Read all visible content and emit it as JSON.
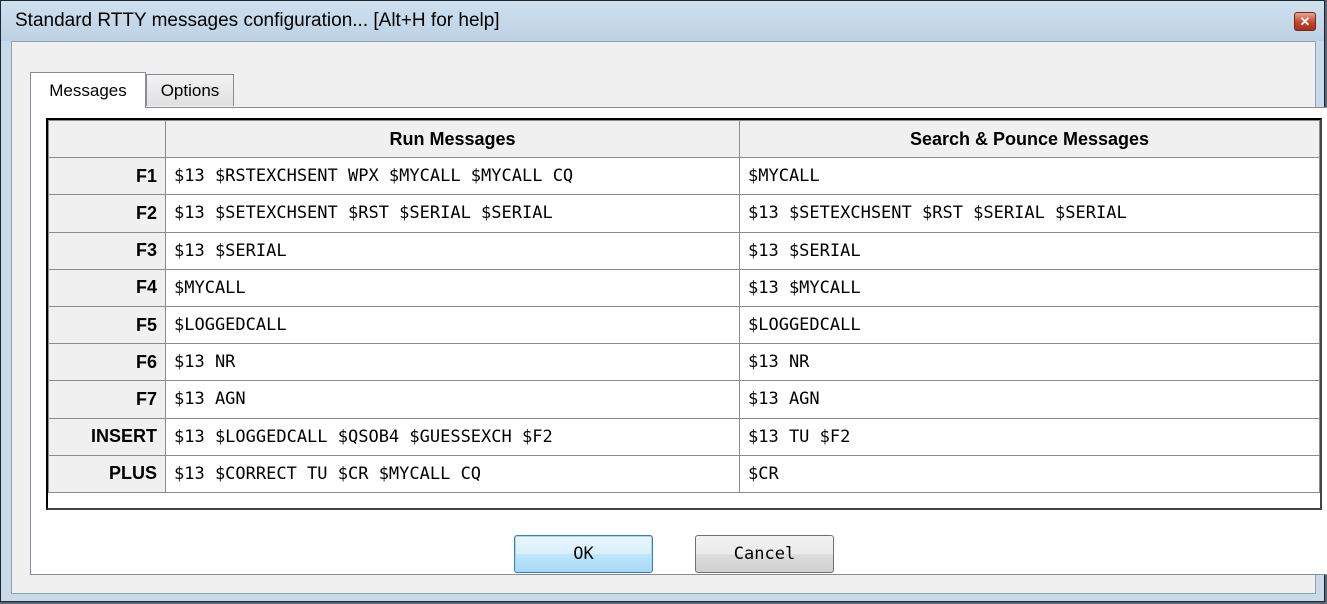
{
  "window": {
    "title": "Standard RTTY messages configuration... [Alt+H for help]",
    "close_glyph": "✕"
  },
  "tabs": [
    {
      "label": "Messages",
      "active": true
    },
    {
      "label": "Options",
      "active": false
    }
  ],
  "grid": {
    "headers": [
      "",
      "Run Messages",
      "Search & Pounce Messages"
    ],
    "rows": [
      {
        "key": "F1",
        "run": "$13 $RSTEXCHSENT WPX $MYCALL $MYCALL CQ",
        "sp": "$MYCALL"
      },
      {
        "key": "F2",
        "run": "$13 $SETEXCHSENT $RST $SERIAL $SERIAL",
        "sp": "$13 $SETEXCHSENT $RST $SERIAL $SERIAL"
      },
      {
        "key": "F3",
        "run": "$13 $SERIAL",
        "sp": "$13 $SERIAL"
      },
      {
        "key": "F4",
        "run": "$MYCALL",
        "sp": "$13 $MYCALL"
      },
      {
        "key": "F5",
        "run": "$LOGGEDCALL",
        "sp": "$LOGGEDCALL"
      },
      {
        "key": "F6",
        "run": "$13 NR",
        "sp": "$13 NR"
      },
      {
        "key": "F7",
        "run": "$13 AGN",
        "sp": "$13 AGN"
      },
      {
        "key": "INSERT",
        "run": "$13 $LOGGEDCALL $QSOB4 $GUESSEXCH $F2",
        "sp": "$13 TU $F2"
      },
      {
        "key": "PLUS",
        "run": "$13 $CORRECT TU $CR $MYCALL CQ",
        "sp": "$CR"
      }
    ]
  },
  "buttons": {
    "ok": "OK",
    "cancel": "Cancel"
  }
}
